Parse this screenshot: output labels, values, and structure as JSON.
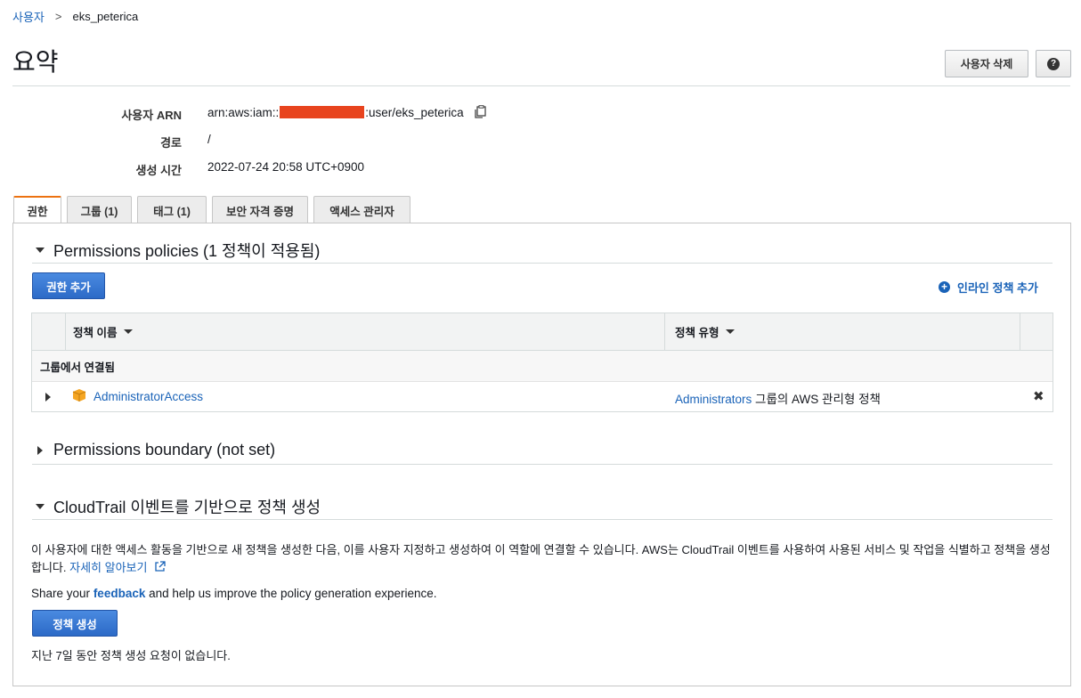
{
  "breadcrumb": {
    "root": "사용자",
    "separator": ">",
    "current": "eks_peterica"
  },
  "page": {
    "title": "요약"
  },
  "header_buttons": {
    "delete_user": "사용자 삭제",
    "help": "?"
  },
  "summary": {
    "arn_label": "사용자 ARN",
    "arn_prefix": "arn:aws:iam::",
    "arn_suffix": ":user/eks_peterica",
    "path_label": "경로",
    "path_value": "/",
    "created_label": "생성 시간",
    "created_value": "2022-07-24 20:58 UTC+0900"
  },
  "tabs": [
    {
      "label": "권한",
      "active": true
    },
    {
      "label": "그룹 (1)",
      "active": false
    },
    {
      "label": "태그 (1)",
      "active": false
    },
    {
      "label": "보안 자격 증명",
      "active": false
    },
    {
      "label": "액세스 관리자",
      "active": false
    }
  ],
  "permissions": {
    "header": "Permissions policies (1 정책이 적용됨)",
    "add_button": "권한 추가",
    "inline_policy": "인라인 정책 추가",
    "table": {
      "col_name": "정책 이름",
      "col_type": "정책 유형",
      "group_label": "그룹에서 연결됨",
      "rows": [
        {
          "name": "AdministratorAccess",
          "type_link": "Administrators",
          "type_text": "그룹의 AWS 관리형 정책"
        }
      ]
    }
  },
  "boundary": {
    "header": "Permissions boundary (not set)"
  },
  "cloudtrail": {
    "header": "CloudTrail 이벤트를 기반으로 정책 생성",
    "description": "이 사용자에 대한 액세스 활동을 기반으로 새 정책을 생성한 다음, 이를 사용자 지정하고 생성하여 이 역할에 연결할 수 있습니다. AWS는 CloudTrail 이벤트를 사용하여 사용된 서비스 및 작업을 식별하고 정책을 생성합니다.",
    "learn_more": "자세히 알아보기",
    "feedback_prefix": "Share your",
    "feedback_link": "feedback",
    "feedback_suffix": "and help us improve the policy generation experience.",
    "generate_button": "정책 생성",
    "no_requests": "지난 7일 동안 정책 생성 요청이 없습니다."
  },
  "colors": {
    "accent_orange": "#ec7211",
    "link_blue": "#1a63b8",
    "primary_blue": "#2c6ac7",
    "redaction": "#e8441e"
  }
}
